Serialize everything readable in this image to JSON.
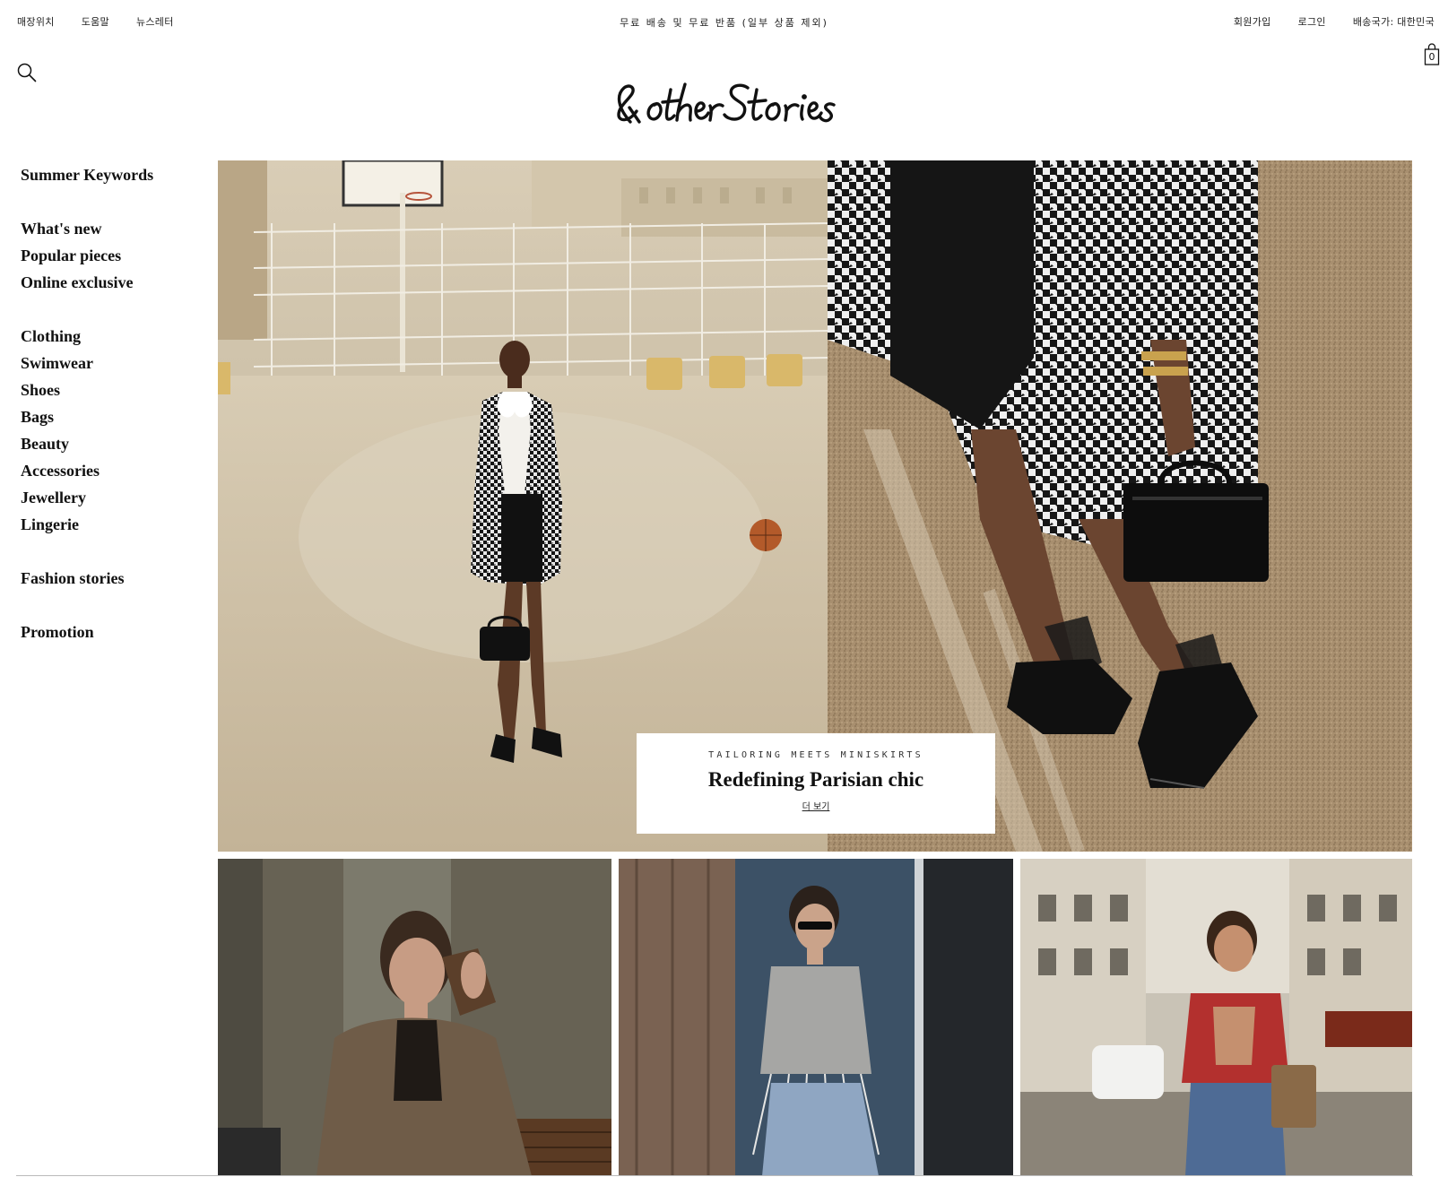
{
  "top_bar": {
    "left_links": [
      "매장위치",
      "도움말",
      "뉴스레터"
    ],
    "promo_text": "무료 배송 및 무료 반품 (일부 상품 제외)",
    "right_links": [
      "회원가입",
      "로그인",
      "배송국가: 대한민국"
    ]
  },
  "header": {
    "logo_text": "& other Stories",
    "cart_count": "0",
    "icons": {
      "search": "search-icon",
      "cart": "shopping-bag-icon"
    }
  },
  "sidebar": {
    "groups": [
      [
        "Summer Keywords"
      ],
      [
        "What's new",
        "Popular pieces",
        "Online exclusive"
      ],
      [
        "Clothing",
        "Swimwear",
        "Shoes",
        "Bags",
        "Beauty",
        "Accessories",
        "Jewellery",
        "Lingerie"
      ],
      [
        "Fashion stories"
      ],
      [
        "Promotion"
      ]
    ]
  },
  "hero": {
    "eyebrow": "TAILORING MEETS MINISKIRTS",
    "title": "Redefining Parisian chic",
    "link": "더 보기"
  },
  "colors": {
    "text": "#111111",
    "background": "#ffffff",
    "divider": "#bbbbbb"
  }
}
